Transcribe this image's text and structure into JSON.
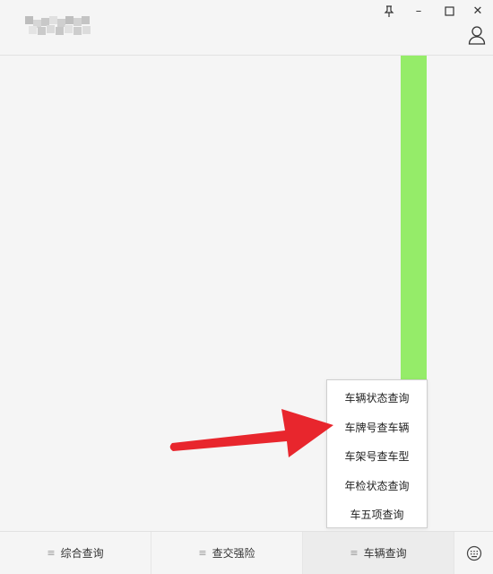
{
  "window": {
    "pin_icon": "pin-icon",
    "minimize_label": "–",
    "maximize_icon": "maximize-icon",
    "close_label": "✕"
  },
  "header": {
    "avatar_icon": "user-icon"
  },
  "popup_menu": {
    "items": [
      {
        "label": "车辆状态查询"
      },
      {
        "label": "车牌号查车辆"
      },
      {
        "label": "车架号查车型"
      },
      {
        "label": "年检状态查询"
      },
      {
        "label": "车五项查询"
      }
    ]
  },
  "bottom_bar": {
    "tabs": [
      {
        "label": "综合查询"
      },
      {
        "label": "查交强险"
      },
      {
        "label": "车辆查询"
      }
    ],
    "menu_glyph": "≡",
    "keyboard_icon": "keyboard-icon"
  },
  "colors": {
    "highlight_bar": "#95ec69",
    "arrow": "#e8262d"
  }
}
